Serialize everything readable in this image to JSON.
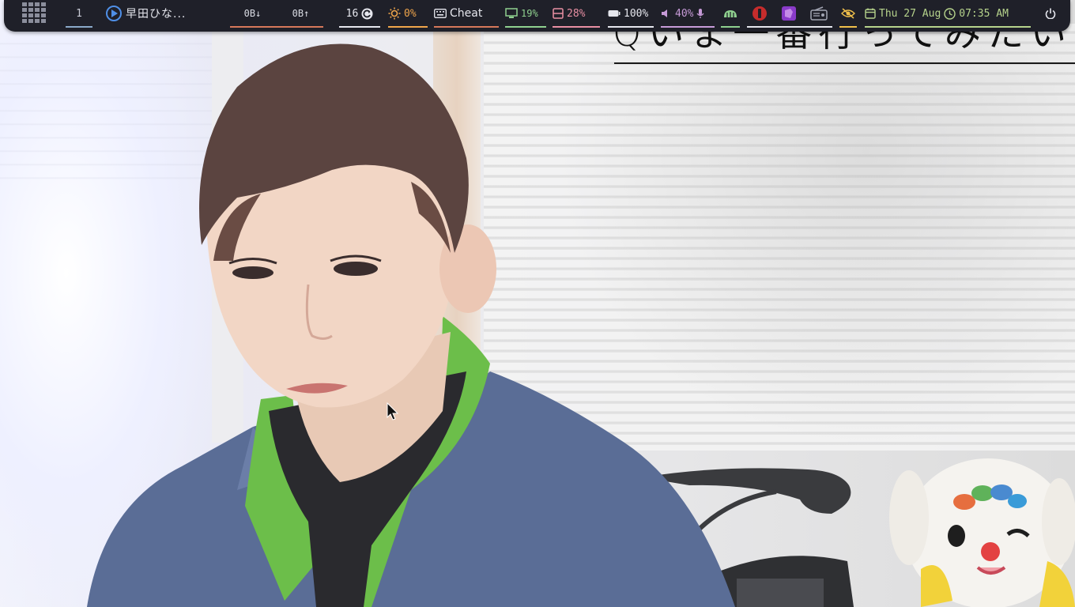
{
  "topbar": {
    "launcher_icon": "grid-icon",
    "workspace": "1",
    "active_app": {
      "icon": "media-player-icon",
      "title": "早田ひな..."
    },
    "network": {
      "down": "0B↓",
      "up": "0B↑"
    },
    "updates": {
      "count": "16",
      "icon": "refresh-icon"
    },
    "brightness": {
      "icon": "sun-icon",
      "value": "0%"
    },
    "cheatsheet": {
      "icon": "keyboard-icon",
      "label": "Cheat"
    },
    "cpu": {
      "icon": "monitor-icon",
      "value": "19%"
    },
    "memory": {
      "icon": "memory-icon",
      "value": "28%"
    },
    "battery": {
      "icon": "battery-icon",
      "value": "100%"
    },
    "volume": {
      "icon": "speaker-icon",
      "value": "40%",
      "mic_icon": "microphone-icon"
    },
    "tray": [
      "android-icon",
      "red-app-icon",
      "purple-app-icon",
      "radio-icon",
      "eye-off-icon"
    ],
    "clock": {
      "date": "Thu 27 Aug",
      "time": "07:35 AM"
    },
    "power_icon": "power-icon",
    "colors": {
      "bar_bg": "#1f2029",
      "workspace_underline": "#8aa9c9",
      "network_underline": "#d6785a",
      "updates_underline": "#e6e7ee",
      "brightness_underline": "#f0a54b",
      "cheat_underline": "#d6785a",
      "cpu_underline": "#8fd08f",
      "memory_underline": "#e88fa3",
      "battery_underline": "#e6e7ee",
      "volume_underline": "#c79bd8",
      "tray_underline": "#8fd08f",
      "clock_underline": "#b6d38c"
    }
  },
  "video": {
    "subtitle_text": "Qいま一番行ってみたい"
  }
}
